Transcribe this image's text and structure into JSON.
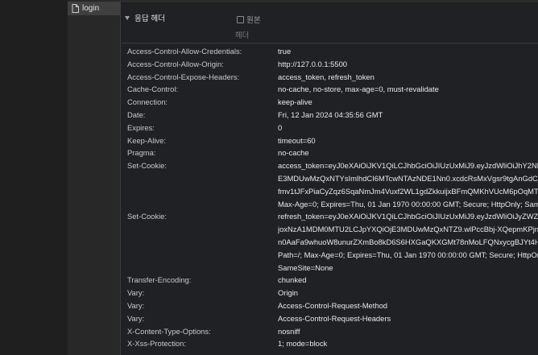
{
  "sidebar": {
    "file_name": "login"
  },
  "section": {
    "title": "응답 헤더",
    "raw_label": "원본",
    "subheading": "헤더"
  },
  "headers": [
    {
      "name": "Access-Control-Allow-Credentials:",
      "lines": [
        "true"
      ]
    },
    {
      "name": "Access-Control-Allow-Origin:",
      "lines": [
        "http://127.0.0.1:5500"
      ]
    },
    {
      "name": "Access-Control-Expose-Headers:",
      "lines": [
        "access_token, refresh_token"
      ]
    },
    {
      "name": "Cache-Control:",
      "lines": [
        "no-cache, no-store, max-age=0, must-revalidate"
      ]
    },
    {
      "name": "Connection:",
      "lines": [
        "keep-alive"
      ]
    },
    {
      "name": "Date:",
      "lines": [
        "Fri, 12 Jan 2024 04:35:56 GMT"
      ]
    },
    {
      "name": "Expires:",
      "lines": [
        "0"
      ]
    },
    {
      "name": "Keep-Alive:",
      "lines": [
        "timeout=60"
      ]
    },
    {
      "name": "Pragma:",
      "lines": [
        "no-cache"
      ]
    },
    {
      "name": "Set-Cookie:",
      "lines": [
        "access_token=eyJ0eXAiOiJKV1QiLCJhbGciOiJIUzUxMiJ9.eyJzdWliOiJhY2Nlc3M",
        "E3MDUwMzQxNTYsImlhdCI6MTcwNTAzNDE1Nn0.xcdcRsMxVgsr9tgAnGdCjQ",
        "fmv1tJFxPiaCyZqz6SqaNmJm4Vuxf2WL1gdZkkuijxBFmQMKhVUcM6pOqMTg",
        "Max-Age=0; Expires=Thu, 01 Jan 1970 00:00:00 GMT; Secure; HttpOnly; Same"
      ]
    },
    {
      "name": "Set-Cookie:",
      "lines": [
        "refresh_token=eyJ0eXAiOiJKV1QiLCJhbGciOiJIUzUxMiJ9.eyJzdWliOiJyZWZyZX",
        "joxNzA1MDM0MTU2LCJpYXQiOjE3MDUwMzQxNTZ9.wlPccBbj-XQepmKPjn4T",
        "n0AaFa9whuoW8unurZXmBo8kD6S6HXGaQKXGMt78nMoLFQNxycgBJYt4HBF",
        "Path=/; Max-Age=0; Expires=Thu, 01 Jan 1970 00:00:00 GMT; Secure; HttpOnl",
        "SameSite=None"
      ]
    },
    {
      "name": "Transfer-Encoding:",
      "lines": [
        "chunked"
      ]
    },
    {
      "name": "Vary:",
      "lines": [
        "Origin"
      ]
    },
    {
      "name": "Vary:",
      "lines": [
        "Access-Control-Request-Method"
      ]
    },
    {
      "name": "Vary:",
      "lines": [
        "Access-Control-Request-Headers"
      ]
    },
    {
      "name": "X-Content-Type-Options:",
      "lines": [
        "nosniff"
      ]
    },
    {
      "name": "X-Xss-Protection:",
      "lines": [
        "1; mode=block"
      ]
    }
  ]
}
